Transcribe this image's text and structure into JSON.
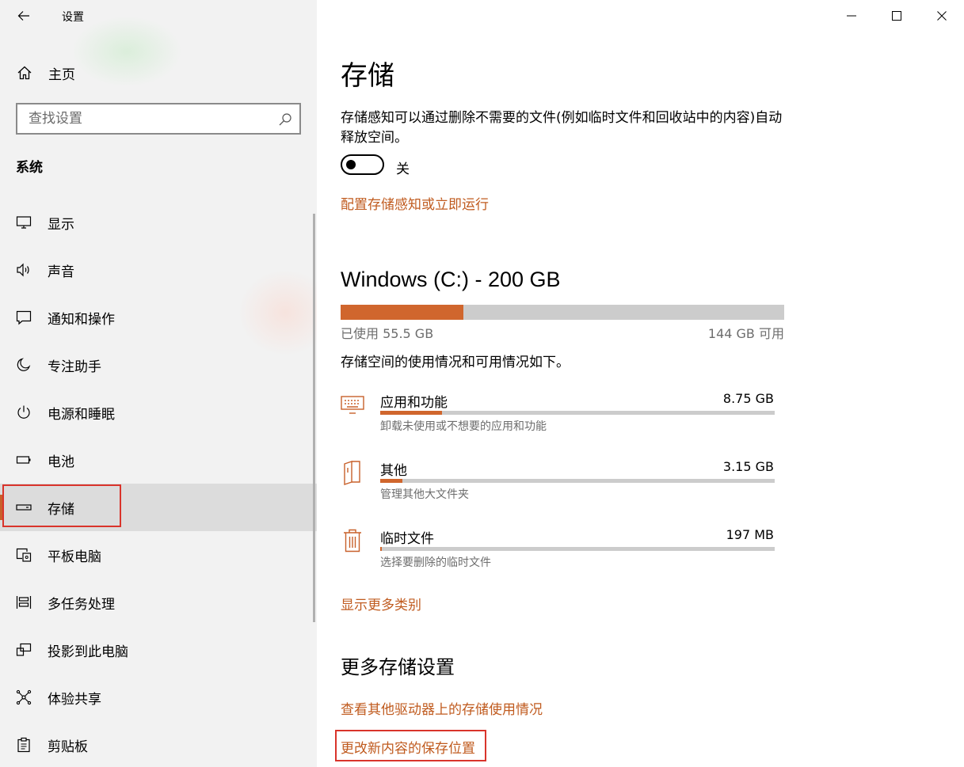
{
  "window": {
    "title": "设置"
  },
  "sidebar": {
    "home_label": "主页",
    "search_placeholder": "查找设置",
    "section_title": "系统",
    "items": [
      {
        "label": "显示",
        "icon": "monitor-icon"
      },
      {
        "label": "声音",
        "icon": "speaker-icon"
      },
      {
        "label": "通知和操作",
        "icon": "notification-icon"
      },
      {
        "label": "专注助手",
        "icon": "moon-icon"
      },
      {
        "label": "电源和睡眠",
        "icon": "power-icon"
      },
      {
        "label": "电池",
        "icon": "battery-icon"
      },
      {
        "label": "存储",
        "icon": "storage-drive-icon",
        "selected": true
      },
      {
        "label": "平板电脑",
        "icon": "tablet-icon"
      },
      {
        "label": "多任务处理",
        "icon": "multitasking-icon"
      },
      {
        "label": "投影到此电脑",
        "icon": "project-icon"
      },
      {
        "label": "体验共享",
        "icon": "share-icon"
      },
      {
        "label": "剪贴板",
        "icon": "clipboard-icon"
      }
    ]
  },
  "main": {
    "title": "存储",
    "description": "存储感知可以通过删除不需要的文件(例如临时文件和回收站中的内容)自动释放空间。",
    "toggle": {
      "state_label": "关",
      "on": false
    },
    "config_link": "配置存储感知或立即运行",
    "drive": {
      "title": "Windows (C:) - 200 GB",
      "used_text": "已使用 55.5 GB",
      "free_text": "144 GB 可用",
      "used_fraction": 0.2775
    },
    "usage_description": "存储空间的使用情况和可用情况如下。",
    "categories": [
      {
        "name": "应用和功能",
        "size": "8.75 GB",
        "sub": "卸载未使用或不想要的应用和功能",
        "fraction": 0.157,
        "icon": "keyboard-icon"
      },
      {
        "name": "其他",
        "size": "3.15 GB",
        "sub": "管理其他大文件夹",
        "fraction": 0.056,
        "icon": "folder-icon"
      },
      {
        "name": "临时文件",
        "size": "197 MB",
        "sub": "选择要删除的临时文件",
        "fraction": 0.004,
        "icon": "trash-icon"
      }
    ],
    "show_more_link": "显示更多类别",
    "more_settings_title": "更多存储设置",
    "other_drives_link": "查看其他驱动器上的存储使用情况",
    "change_save_link": "更改新内容的保存位置"
  },
  "colors": {
    "accent": "#c8602a",
    "link": "#c05b1f",
    "highlight": "#d9342b"
  }
}
